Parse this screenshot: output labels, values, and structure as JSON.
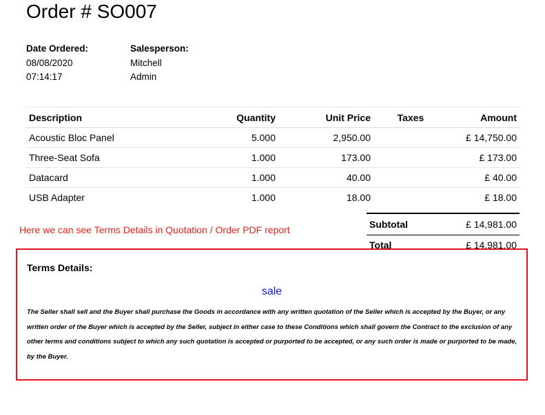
{
  "order": {
    "title": "Order # SO007"
  },
  "info": {
    "date_label": "Date Ordered:",
    "date": "08/08/2020",
    "time": "07:14:17",
    "salesperson_label": "Salesperson:",
    "salesperson_line1": "Mitchell",
    "salesperson_line2": "Admin"
  },
  "table": {
    "headers": {
      "description": "Description",
      "quantity": "Quantity",
      "unit_price": "Unit Price",
      "taxes": "Taxes",
      "amount": "Amount"
    },
    "rows": [
      {
        "description": "Acoustic Bloc Panel",
        "quantity": "5.000",
        "unit_price": "2,950.00",
        "taxes": "",
        "amount": "£ 14,750.00"
      },
      {
        "description": "Three-Seat Sofa",
        "quantity": "1.000",
        "unit_price": "173.00",
        "taxes": "",
        "amount": "£ 173.00"
      },
      {
        "description": "Datacard",
        "quantity": "1.000",
        "unit_price": "40.00",
        "taxes": "",
        "amount": "£ 40.00"
      },
      {
        "description": "USB Adapter",
        "quantity": "1.000",
        "unit_price": "18.00",
        "taxes": "",
        "amount": "£ 18.00"
      }
    ]
  },
  "annotation": {
    "text": "Here we can see Terms Details in Quotation / Order PDF report",
    "color": "#e8231b"
  },
  "totals": {
    "subtotal_label": "Subtotal",
    "subtotal": "£ 14,981.00",
    "total_label": "Total",
    "total": "£ 14,981.00"
  },
  "terms": {
    "heading": "Terms Details:",
    "keyword": "sale",
    "keyword_color": "#1414e0",
    "border_color": "#e0141e",
    "text": "The Seller shall sell and the Buyer shall purchase the Goods in accordance with any written quotation of the Seller which is accepted by the Buyer, or any written order of the Buyer which is accepted by the Seller, subject in either case to these Conditions which shall govern the Contract to the exclusion of any other terms and conditions subject to which any such quotation is accepted or purported to be accepted, or any such order is made or purported to be made, by the Buyer."
  }
}
